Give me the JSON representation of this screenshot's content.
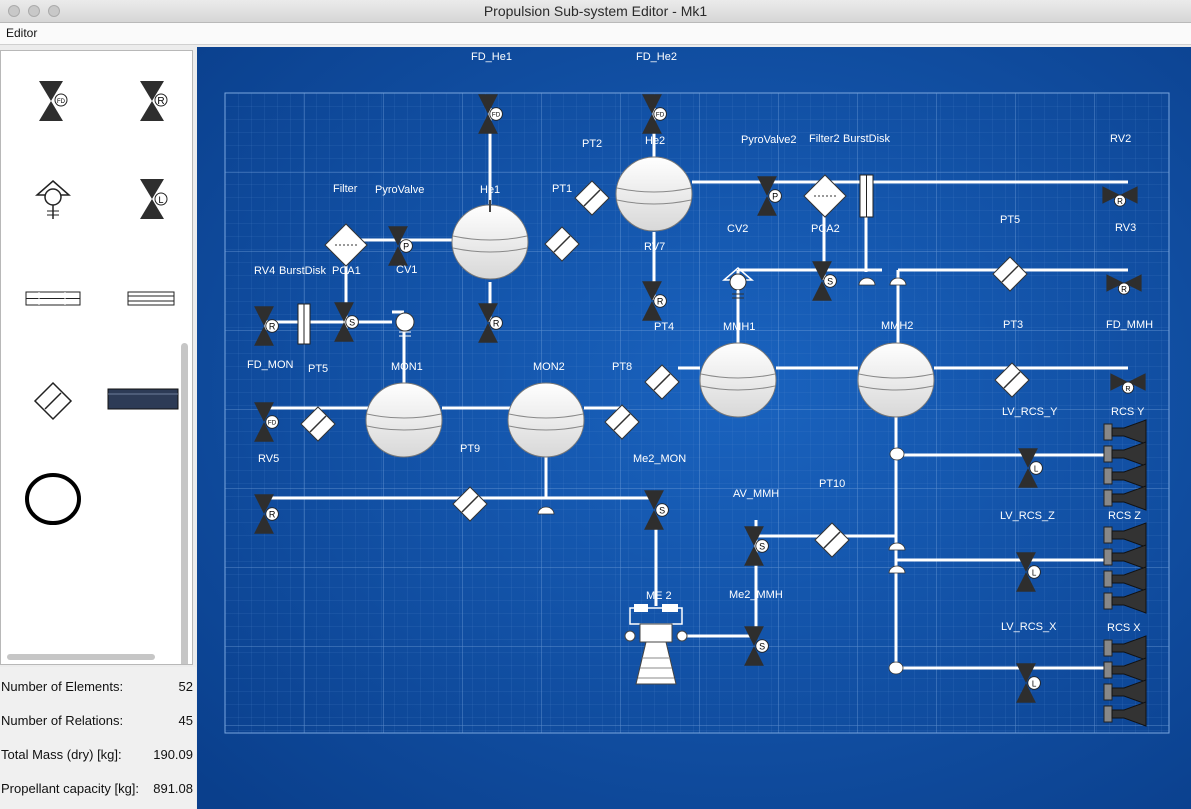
{
  "window": {
    "title": "Propulsion Sub-system Editor -  Mk1"
  },
  "menu": {
    "editor_label": "Editor"
  },
  "stats": {
    "elements_label": "Number of Elements:",
    "elements_value": "52",
    "relations_label": "Number of Relations:",
    "relations_value": "45",
    "mass_label": "Total Mass (dry) [kg]:",
    "mass_value": "190.09",
    "capacity_label": "Propellant capacity [kg]:",
    "capacity_value": "891.08"
  },
  "palette": {
    "items": [
      {
        "name": "fill-drain-valve",
        "icon": "valve-icon",
        "tag": "FD"
      },
      {
        "name": "relief-valve",
        "icon": "valve-icon",
        "tag": "R"
      },
      {
        "name": "pressure-transducer",
        "icon": "transducer-icon"
      },
      {
        "name": "latch-valve",
        "icon": "valve-icon",
        "tag": "L"
      },
      {
        "name": "filter",
        "icon": "filter-icon"
      },
      {
        "name": "burst-disk",
        "icon": "burst-disk-icon"
      },
      {
        "name": "check-valve",
        "icon": "check-valve-icon"
      },
      {
        "name": "pipe",
        "icon": "pipe-icon"
      },
      {
        "name": "tank",
        "icon": "tank-icon"
      }
    ]
  },
  "diagram": {
    "colors": {
      "background": "#0c4a9e",
      "grid": "#5b8fd0",
      "pipe": "#ffffff",
      "valve": "#2e2e2e",
      "tank_fill": "#f4f4f4"
    },
    "labels": {
      "FD_He1": "FD_He1",
      "FD_He2": "FD_He2",
      "PT2": "PT2",
      "He2": "He2",
      "PyroValve2": "PyroValve2",
      "Filter2": "Filter2",
      "BurstDisk2": "BurstDisk",
      "RV2": "RV2",
      "Filter": "Filter",
      "PyroValve": "PyroValve",
      "He1": "He1",
      "PT1": "PT1",
      "RV7": "RV7",
      "CV2": "CV2",
      "PCA2": "PCA2",
      "PT5b": "PT5",
      "RV3": "RV3",
      "RV4": "RV4",
      "BurstDisk": "BurstDisk",
      "PCA1": "PCA1",
      "CV1": "CV1",
      "FD_MON": "FD_MON",
      "PT5": "PT5",
      "PT4": "PT4",
      "MMH1": "MMH1",
      "MMH2": "MMH2",
      "PT3": "PT3",
      "FD_MMH": "FD_MMH",
      "MON1": "MON1",
      "MON2": "MON2",
      "PT8": "PT8",
      "LV_RCS_Y": "LV_RCS_Y",
      "RCS_Y": "RCS Y",
      "RV5": "RV5",
      "PT9": "PT9",
      "Me2_MON": "Me2_MON",
      "AV_MMH": "AV_MMH",
      "PT10": "PT10",
      "LV_RCS_Z": "LV_RCS_Z",
      "RCS_Z": "RCS Z",
      "ME2": "ME 2",
      "Me2_MMH": "Me2_MMH",
      "LV_RCS_X": "LV_RCS_X",
      "RCS_X": "RCS X"
    }
  }
}
